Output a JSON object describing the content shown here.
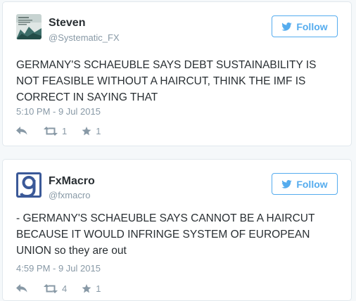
{
  "colors": {
    "brand_blue": "#55acee",
    "text_primary": "#292f33",
    "text_muted": "#8899a6",
    "border": "#e1e8ed"
  },
  "tweets": [
    {
      "name": "Steven",
      "handle": "@Systematic_FX",
      "follow_label": "Follow",
      "text": "GERMANY'S SCHAEUBLE SAYS DEBT SUSTAINABILITY IS NOT FEASIBLE WITHOUT A HAIRCUT, THINK THE IMF IS CORRECT IN SAYING THAT",
      "timestamp": "5:10 PM - 9 Jul 2015",
      "retweets": "1",
      "favorites": "1",
      "icons": [
        "reply-icon",
        "retweet-icon",
        "favorite-star-icon",
        "twitter-bird-icon"
      ]
    },
    {
      "name": "FxMacro",
      "handle": "@fxmacro",
      "follow_label": "Follow",
      "text": "- GERMANY'S SCHAEUBLE SAYS  CANNOT BE A HAIRCUT BECAUSE IT WOULD INFRINGE SYSTEM OF EUROPEAN UNION so they are out",
      "timestamp": "4:59 PM - 9 Jul 2015",
      "retweets": "4",
      "favorites": "1",
      "icons": [
        "reply-icon",
        "retweet-icon",
        "favorite-star-icon",
        "twitter-bird-icon"
      ]
    }
  ]
}
